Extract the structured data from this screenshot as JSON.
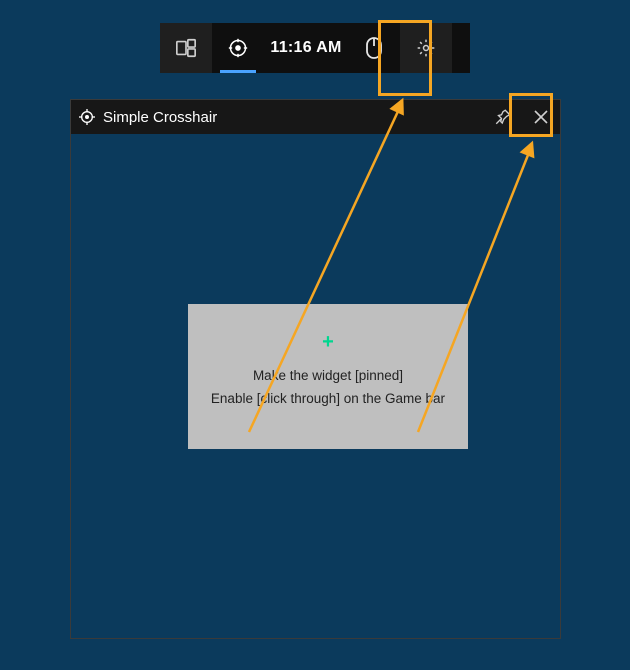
{
  "gamebar": {
    "time": "11:16 AM"
  },
  "widget": {
    "title": "Simple Crosshair"
  },
  "panel": {
    "line1": "Make the widget [pinned]",
    "line2": "Enable [click through] on the Game bar"
  },
  "colors": {
    "accent": "#f5a623",
    "active": "#4aa3ff",
    "plus": "#00d68f"
  }
}
